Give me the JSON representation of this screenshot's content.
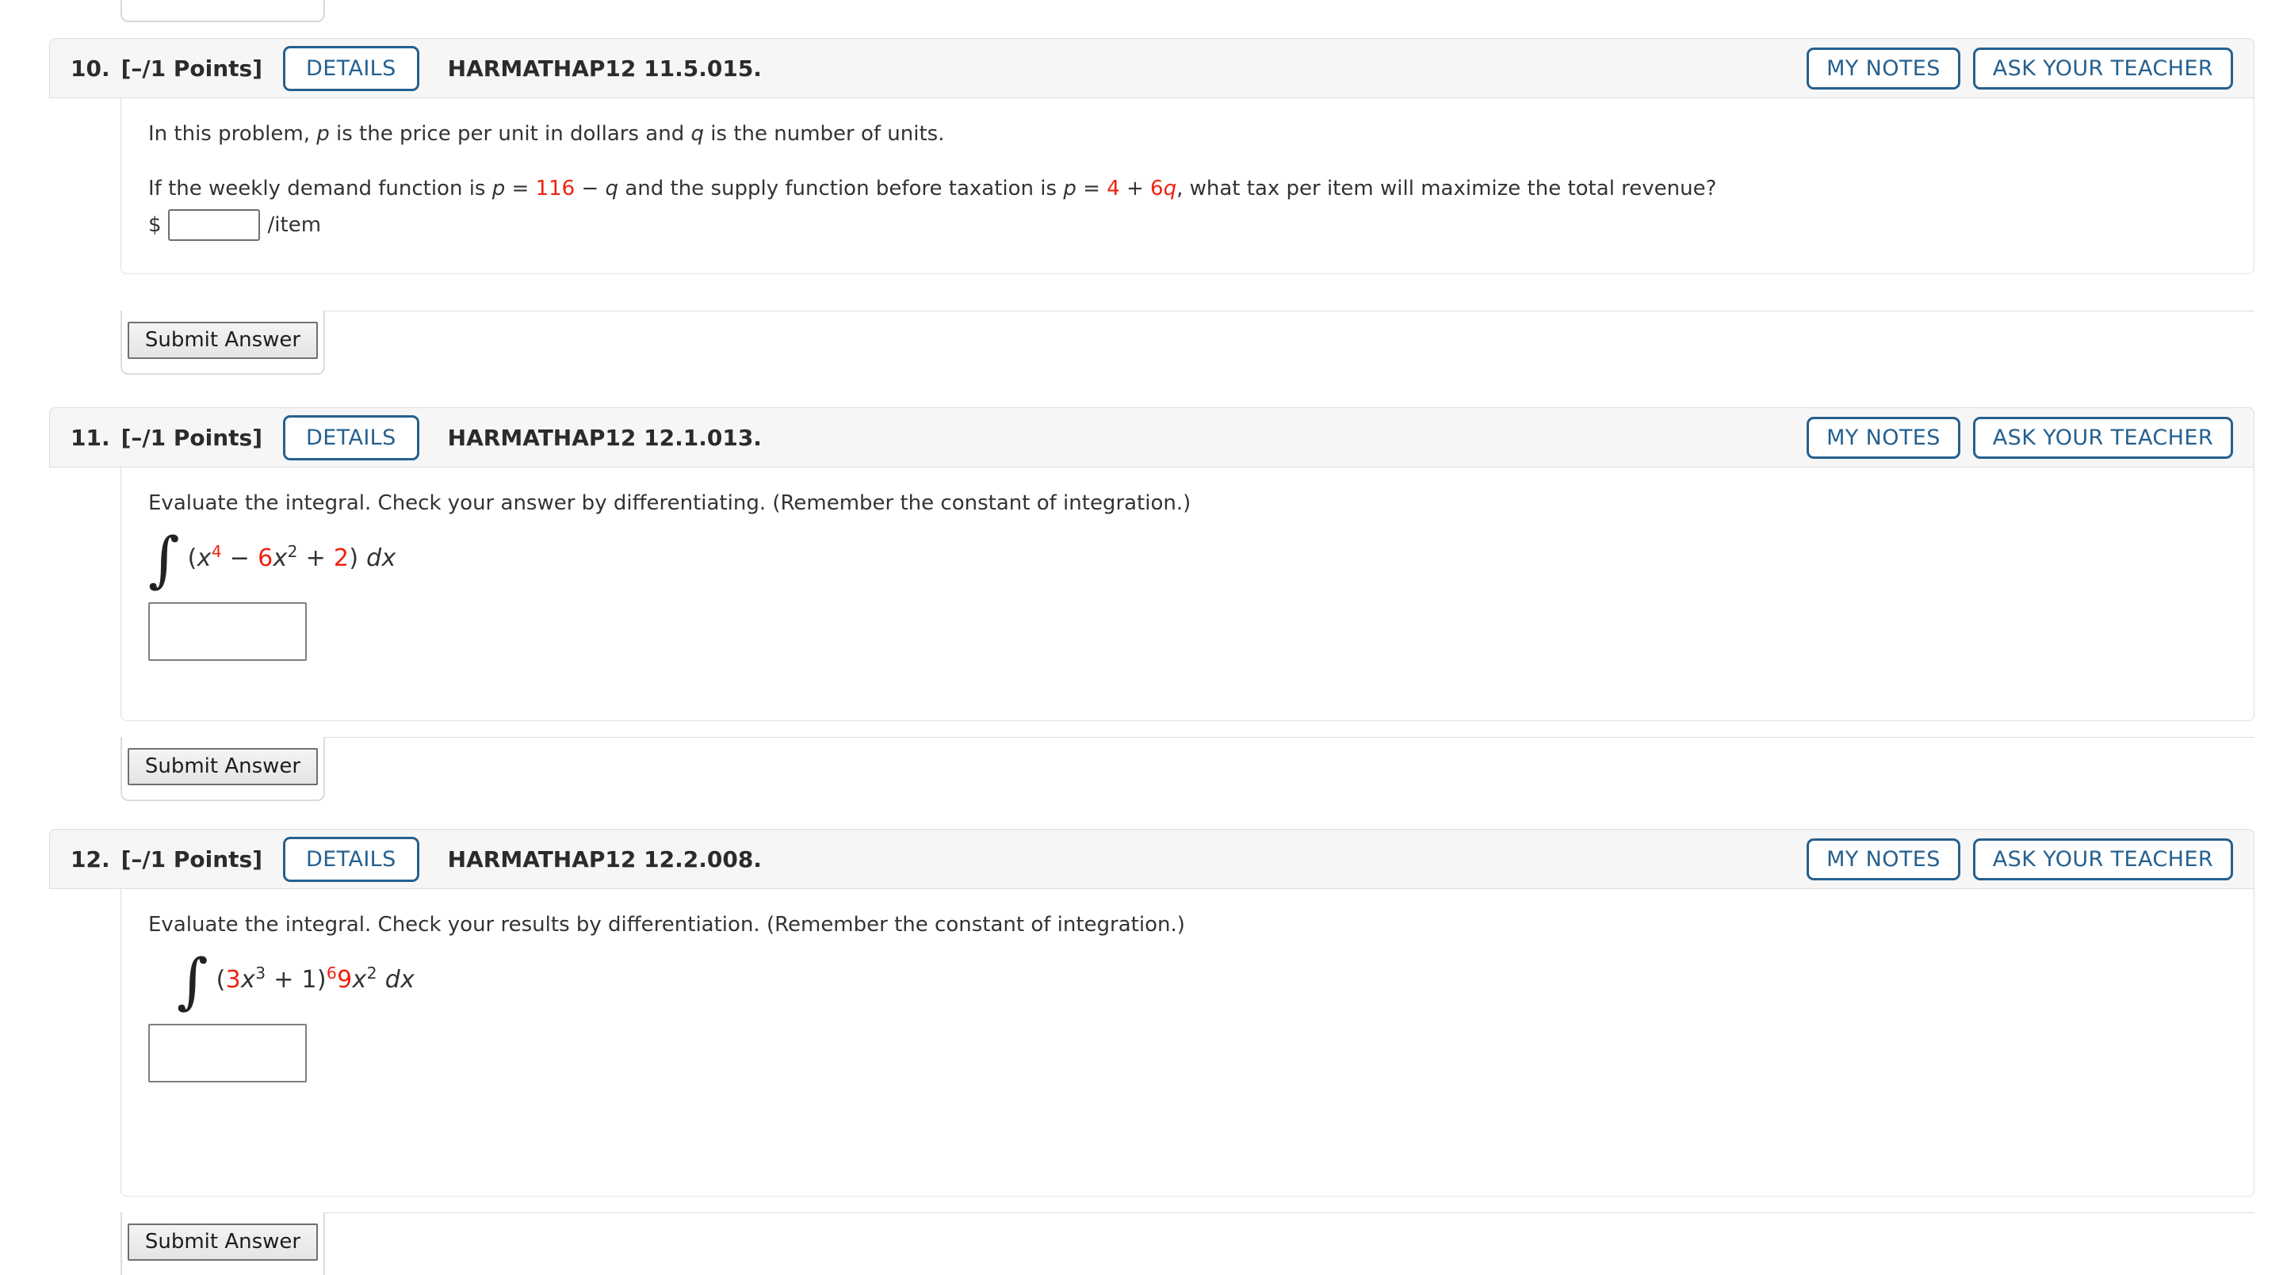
{
  "page": {
    "app": "WebAssign Assignment Problems",
    "textbook_code": "HARMATHAP12"
  },
  "labels": {
    "details": "DETAILS",
    "my_notes": "MY NOTES",
    "ask_your_teacher": "ASK YOUR TEACHER",
    "submit_answer": "Submit Answer",
    "dollar_sign": "$",
    "per_item": "/item"
  },
  "colors": {
    "accent_blue": "#25608f",
    "math_highlight_red": "#ee2211",
    "header_bg": "#f6f6f6",
    "card_border": "#dddddd"
  },
  "problems": [
    {
      "number": "10.",
      "points": "[–/1 Points]",
      "code": "HARMATHAP12 11.5.015.",
      "paragraph1_pre": "In this problem, ",
      "paragraph1_var1": "p",
      "paragraph1_mid": " is the price per unit in dollars and ",
      "paragraph1_var2": "q",
      "paragraph1_post": " is the number of units.",
      "paragraph2_seg1": "If the weekly demand function is ",
      "paragraph2_p1": "p",
      "paragraph2_eq1": " = ",
      "paragraph2_num1": "116",
      "paragraph2_op1": " − ",
      "paragraph2_q1": "q",
      "paragraph2_seg2": " and the supply function before taxation is ",
      "paragraph2_p2": "p",
      "paragraph2_eq2": " = ",
      "paragraph2_num2": "4",
      "paragraph2_op2": " + ",
      "paragraph2_num3": "6",
      "paragraph2_q2": "q",
      "paragraph2_seg3": ", what tax per item will maximize the total revenue?",
      "answer_value": "",
      "answer_placeholder": ""
    },
    {
      "number": "11.",
      "points": "[–/1 Points]",
      "code": "HARMATHAP12 12.1.013.",
      "instruction": "Evaluate the integral. Check your answer by differentiating. (Remember the constant of integration.)",
      "integral_sign": "∫",
      "expr_open": "(",
      "expr_x1": "x",
      "expr_exp1": "4",
      "expr_op1": " − ",
      "expr_coef1": "6",
      "expr_x2": "x",
      "expr_exp2": "2",
      "expr_op2": " + ",
      "expr_coef2": "2",
      "expr_close": ") ",
      "expr_dx": "dx",
      "answer_value": "",
      "answer_placeholder": ""
    },
    {
      "number": "12.",
      "points": "[–/1 Points]",
      "code": "HARMATHAP12 12.2.008.",
      "instruction": "Evaluate the integral. Check your results by differentiation. (Remember the constant of integration.)",
      "integral_sign": "∫",
      "expr_open": "(",
      "expr_coef1": "3",
      "expr_x1": "x",
      "expr_exp1": "3",
      "expr_op1": " + ",
      "expr_const": "1",
      "expr_close": ")",
      "expr_power": "6",
      "expr_coef2": "9",
      "expr_x2": "x",
      "expr_exp2": "2",
      "expr_space": " ",
      "expr_dx": "dx",
      "answer_value": "",
      "answer_placeholder": ""
    }
  ]
}
